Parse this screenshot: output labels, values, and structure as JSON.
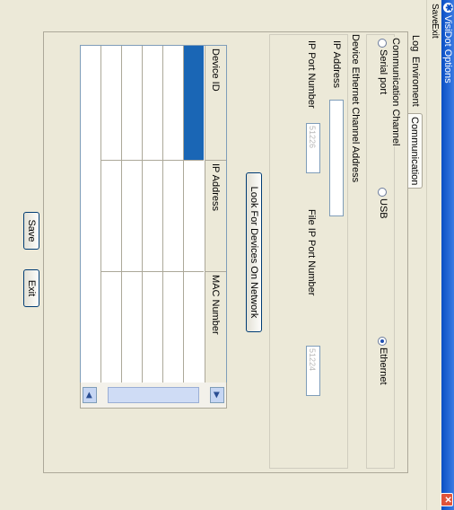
{
  "window": {
    "title": "VisiDot Options",
    "close": "✕"
  },
  "menu": {
    "items": [
      "Save",
      "Exit"
    ]
  },
  "tabs": [
    {
      "label": "Log"
    },
    {
      "label": "Enviroment"
    },
    {
      "label": "Communication"
    }
  ],
  "communication": {
    "channel_group_title": "Communication Channel",
    "channel_options": [
      {
        "label": "Serial port",
        "checked": false
      },
      {
        "label": "USB",
        "checked": false
      },
      {
        "label": "Ethernet",
        "checked": true
      }
    ],
    "ethernet_group_title": "Device Ethernet Channel Address",
    "ip_address_label": "IP Address",
    "ip_address_value": "",
    "ip_port_label": "IP Port Number",
    "ip_port_value": "51226",
    "file_ip_port_label": "File IP Port Number",
    "file_ip_port_value": "51224",
    "look_button": "Look For Devices On Network",
    "table": {
      "columns": [
        "Device ID",
        "IP Address",
        "MAC Number"
      ],
      "rows": [
        {
          "device_id": "",
          "ip_address": "",
          "mac_number": "",
          "selected": true
        },
        {
          "device_id": "",
          "ip_address": "",
          "mac_number": "",
          "selected": false
        },
        {
          "device_id": "",
          "ip_address": "",
          "mac_number": "",
          "selected": false
        },
        {
          "device_id": "",
          "ip_address": "",
          "mac_number": "",
          "selected": false
        },
        {
          "device_id": "",
          "ip_address": "",
          "mac_number": "",
          "selected": false
        }
      ]
    },
    "scroll_left": "◀",
    "scroll_right": "▶"
  },
  "footer": {
    "save_button": "Save",
    "exit_button": "Exit"
  }
}
